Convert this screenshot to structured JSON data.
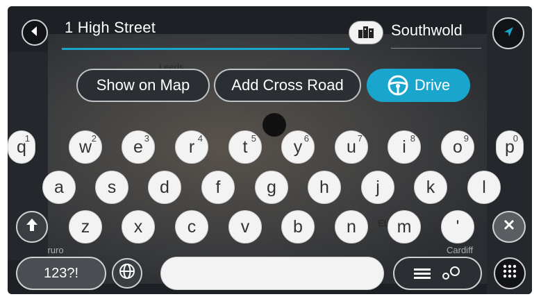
{
  "search": {
    "query": "1 High Street",
    "city": "Southwold"
  },
  "map_labels": [
    "Leeds",
    "Lo",
    "EL",
    "Truro",
    "Cardiff"
  ],
  "actions": {
    "show_on_map": "Show on Map",
    "add_cross_road": "Add Cross Road",
    "drive": "Drive"
  },
  "keyboard": {
    "row1": [
      {
        "key": "q",
        "hint": "1"
      },
      {
        "key": "w",
        "hint": "2"
      },
      {
        "key": "e",
        "hint": "3"
      },
      {
        "key": "r",
        "hint": "4"
      },
      {
        "key": "t",
        "hint": "5"
      },
      {
        "key": "y",
        "hint": "6"
      },
      {
        "key": "u",
        "hint": "7"
      },
      {
        "key": "i",
        "hint": "8"
      },
      {
        "key": "o",
        "hint": "9"
      },
      {
        "key": "p",
        "hint": "0"
      }
    ],
    "row2": [
      "a",
      "s",
      "d",
      "f",
      "g",
      "h",
      "j",
      "k",
      "l"
    ],
    "row3": [
      "z",
      "x",
      "c",
      "v",
      "b",
      "n",
      "m",
      "'"
    ],
    "numbers_key": "123?!"
  },
  "icons": {
    "back": "arrow-left-icon",
    "city": "city-buildings-icon",
    "location": "navigation-arrow-icon",
    "shift": "shift-up-icon",
    "delete": "delete-x-icon",
    "globe": "globe-icon",
    "list": "list-icon",
    "search_mode": "circles-icon",
    "keypad": "keypad-grid-icon",
    "steering": "steering-wheel-icon"
  },
  "colors": {
    "accent": "#1aa6cc",
    "background": "#1d2024",
    "key": "#f3f3f3"
  }
}
